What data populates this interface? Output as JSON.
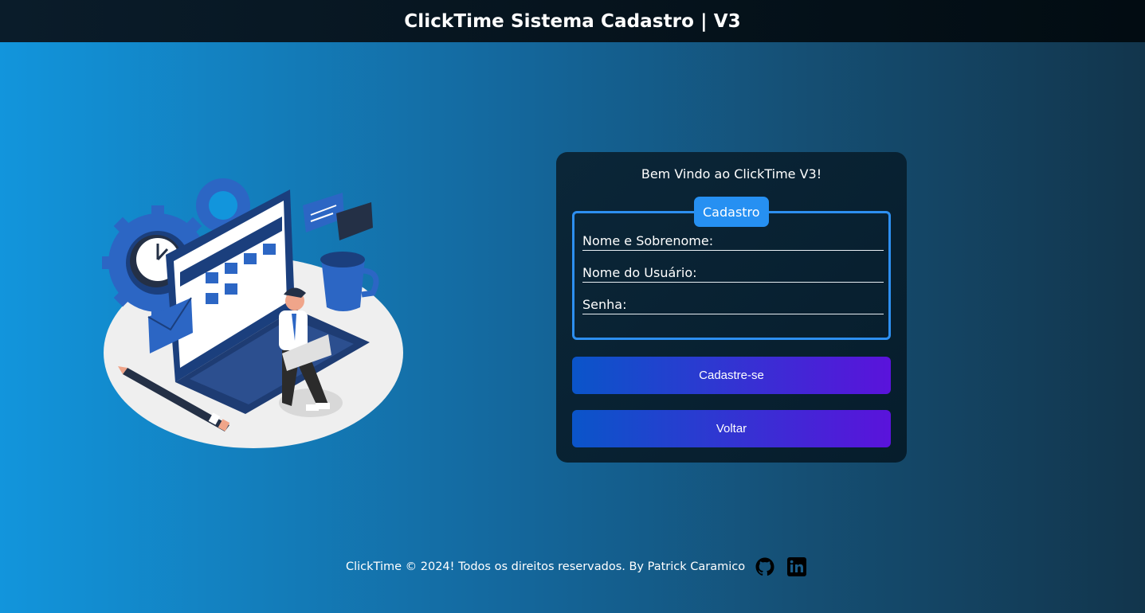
{
  "header": {
    "title": "ClickTime Sistema Cadastro | V3"
  },
  "card": {
    "welcome": "Bem Vindo ao ClickTime V3!",
    "legend": "Cadastro",
    "fields": [
      {
        "label": "Nome e Sobrenome:",
        "value": ""
      },
      {
        "label": "Nome do Usuário:",
        "value": ""
      },
      {
        "label": "Senha:",
        "value": ""
      }
    ],
    "register_button": "Cadastre-se",
    "back_button": "Voltar"
  },
  "footer": {
    "text": "ClickTime © 2024! Todos os direitos reservados. By Patrick Caramico",
    "icons": [
      "github-icon",
      "linkedin-icon"
    ]
  },
  "colors": {
    "accent": "#2690f2",
    "button_gradient_start": "#0a55c9",
    "button_gradient_end": "#5a13db",
    "card_bg": "#0b2638"
  }
}
